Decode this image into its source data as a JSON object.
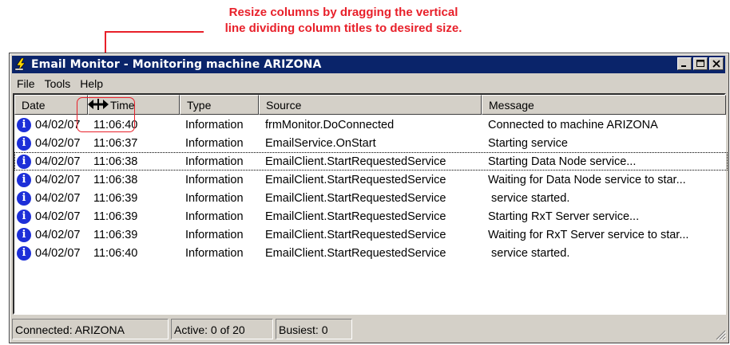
{
  "callout": {
    "line1": "Resize columns by dragging the vertical",
    "line2": "line dividing column titles to desired size."
  },
  "window": {
    "title": "Email Monitor - Monitoring machine ARIZONA",
    "icon": "lightning-tool-icon"
  },
  "menu": {
    "file": "File",
    "tools": "Tools",
    "help": "Help"
  },
  "columns": {
    "date": "Date",
    "time": "Time",
    "type": "Type",
    "source": "Source",
    "message": "Message"
  },
  "rows": [
    {
      "date": "04/02/07",
      "time": "11:06:40",
      "type": "Information",
      "source": "frmMonitor.DoConnected",
      "message": "Connected to machine ARIZONA"
    },
    {
      "date": "04/02/07",
      "time": "11:06:37",
      "type": "Information",
      "source": "EmailService.OnStart",
      "message": "Starting service"
    },
    {
      "date": "04/02/07",
      "time": "11:06:38",
      "type": "Information",
      "source": "EmailClient.StartRequestedService",
      "message": "Starting Data Node service..."
    },
    {
      "date": "04/02/07",
      "time": "11:06:38",
      "type": "Information",
      "source": "EmailClient.StartRequestedService",
      "message": "Waiting for Data Node service to star..."
    },
    {
      "date": "04/02/07",
      "time": "11:06:39",
      "type": "Information",
      "source": "EmailClient.StartRequestedService",
      "message": " service started."
    },
    {
      "date": "04/02/07",
      "time": "11:06:39",
      "type": "Information",
      "source": "EmailClient.StartRequestedService",
      "message": "Starting RxT Server service..."
    },
    {
      "date": "04/02/07",
      "time": "11:06:39",
      "type": "Information",
      "source": "EmailClient.StartRequestedService",
      "message": "Waiting for RxT Server service to star..."
    },
    {
      "date": "04/02/07",
      "time": "11:06:40",
      "type": "Information",
      "source": "EmailClient.StartRequestedService",
      "message": " service started."
    }
  ],
  "status": {
    "connected": "Connected: ARIZONA",
    "active": "Active: 0 of 20",
    "busiest": "Busiest: 0"
  },
  "colors": {
    "callout": "#e8202a",
    "titlebar": "#0a246a",
    "info_icon": "#1d2fd8",
    "chrome": "#d4d0c8"
  }
}
